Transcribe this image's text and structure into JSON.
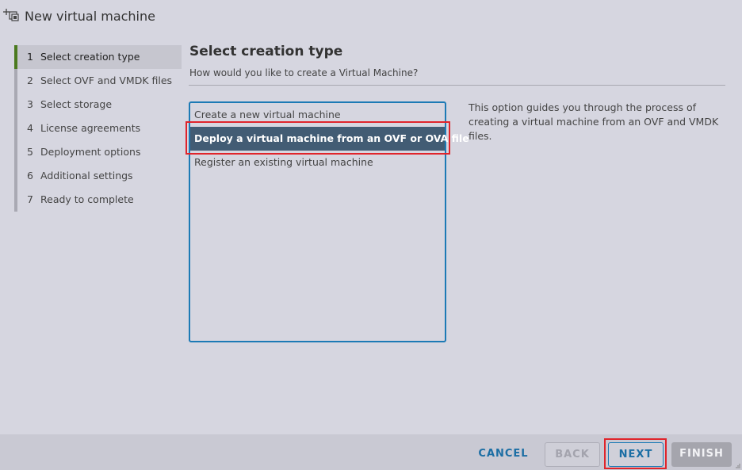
{
  "window": {
    "title": "New virtual machine",
    "icon": "new-vm-icon"
  },
  "sidebar": {
    "steps": [
      {
        "num": "1",
        "label": "Select creation type",
        "active": true
      },
      {
        "num": "2",
        "label": "Select OVF and VMDK files",
        "active": false
      },
      {
        "num": "3",
        "label": "Select storage",
        "active": false
      },
      {
        "num": "4",
        "label": "License agreements",
        "active": false
      },
      {
        "num": "5",
        "label": "Deployment options",
        "active": false
      },
      {
        "num": "6",
        "label": "Additional settings",
        "active": false
      },
      {
        "num": "7",
        "label": "Ready to complete",
        "active": false
      }
    ]
  },
  "main": {
    "title": "Select creation type",
    "subtitle": "How would you like to create a Virtual Machine?",
    "options": [
      {
        "label": "Create a new virtual machine",
        "selected": false
      },
      {
        "label": "Deploy a virtual machine from an OVF or OVA file",
        "selected": true
      },
      {
        "label": "Register an existing virtual machine",
        "selected": false
      }
    ],
    "description": "This option guides you through the process of creating a virtual machine from an OVF and VMDK files."
  },
  "footer": {
    "cancel_label": "CANCEL",
    "back_label": "BACK",
    "next_label": "NEXT",
    "finish_label": "FINISH"
  },
  "colors": {
    "accent": "#1c7ab5",
    "selected_row": "#425c74",
    "active_step_bar": "#4b7a1f",
    "annotation_red": "#e0242b"
  }
}
